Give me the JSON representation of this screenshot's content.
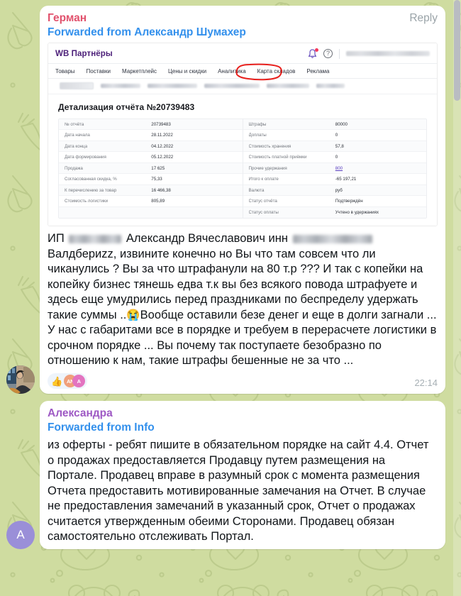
{
  "app": {
    "name": "telegram-chat",
    "accent_pink": "#e1526d",
    "accent_purple": "#9e59c4",
    "accent_blue": "#3390ec",
    "wallpaper_color": "#cfdca0"
  },
  "messages": [
    {
      "sender": "Герман",
      "reply_label": "Reply",
      "forwarded_from": "Forwarded from Александр Шумахер",
      "timestamp": "22:14",
      "avatar": {
        "type": "photo",
        "name": "user-photo-avatar"
      },
      "attachment": {
        "type": "screenshot",
        "site_logo": "WB Партнёры",
        "nav": [
          "Товары",
          "Поставки",
          "Маркетплейс",
          "Цены и скидки",
          "Аналитика",
          "Карта складов",
          "Реклама"
        ],
        "report_title": "Детализация отчёта №20739483",
        "table_left": [
          {
            "label": "№ отчёта",
            "value": "20739483"
          },
          {
            "label": "Дата начала",
            "value": "28.11.2022"
          },
          {
            "label": "Дата конца",
            "value": "04.12.2022"
          },
          {
            "label": "Дата формирования",
            "value": "05.12.2022"
          },
          {
            "label": "Продажа",
            "value": "17 625"
          },
          {
            "label": "Согласованная скидка, %",
            "value": "75,33"
          },
          {
            "label": "К перечислению за товар",
            "value": "16 466,38"
          },
          {
            "label": "Стоимость логистики",
            "value": "805,89"
          }
        ],
        "table_right": [
          {
            "label": "Штрафы",
            "value": "80000",
            "highlighted": true
          },
          {
            "label": "Доплаты",
            "value": "0"
          },
          {
            "label": "Стоимость хранения",
            "value": "57,8"
          },
          {
            "label": "Стоимость платной приёмки",
            "value": "0"
          },
          {
            "label": "Прочие удержания",
            "value": "800",
            "link": true
          },
          {
            "label": "Итого к оплате",
            "value": "-65 197,21"
          },
          {
            "label": "Валюта",
            "value": "руб"
          },
          {
            "label": "Статус отчёта",
            "value": "Подтверждён"
          },
          {
            "label": "Статус оплаты",
            "value": "Учтено в удержаниях"
          }
        ],
        "annotation": "red-circle-around-penalty-amount"
      },
      "text_parts": [
        {
          "type": "text",
          "value": "ИП "
        },
        {
          "type": "redacted",
          "width": "r1"
        },
        {
          "type": "text",
          "value": " Александр Вячеславович инн "
        },
        {
          "type": "redacted",
          "width": "r2"
        },
        {
          "type": "text",
          "value": " Валдбериzz, извините конечно но Вы что там совсем что ли чиканулись ? Вы за что штрафанули на 80 т.р ??? И так с копейки на копейку бизнес тянешь едва т.к вы без всякого повода штрафуете и здесь еще умудрились перед праздниками по беспределу удержать такие суммы .."
        },
        {
          "type": "emoji",
          "value": "😭"
        },
        {
          "type": "text",
          "value": "Вообще оставили безе денег и еще в долги загнали ... У нас с габаритами все в порядке и требуем в перерасчете логистики в срочном порядке ... Вы почему так поступаете безобразно по отношению к нам, такие штрафы бешенные не за что ..."
        }
      ],
      "reactions": [
        {
          "emoji": "👍",
          "avatars": [
            "AN",
            "A"
          ]
        }
      ]
    },
    {
      "sender": "Александра",
      "forwarded_from": "Forwarded from Info",
      "avatar": {
        "type": "letter",
        "letter": "A",
        "name": "letter-avatar"
      },
      "text": "из оферты - ребят пишите в обязательном порядке на сайт\n4.4. Отчет о продажах предоставляется Продавцу путем размещения на Портале. Продавец вправе в разумный срок с момента\nразмещения Отчета предоставить мотивированные замечания на Отчет. В случае не предоставления замечаний в указанный срок, Отчет о продажах считается утвержденным обеими Сторонами. Продавец обязан самостоятельно отслеживать Портал."
    }
  ]
}
